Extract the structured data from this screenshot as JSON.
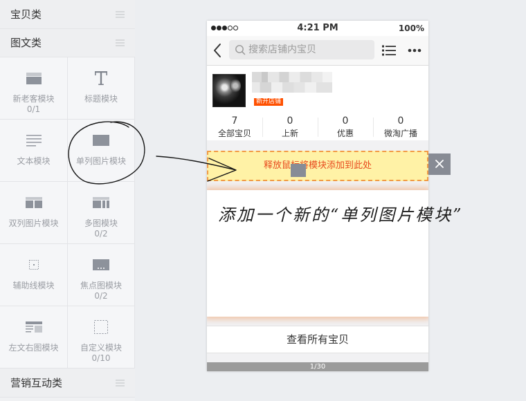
{
  "sidebar": {
    "categories": [
      {
        "label": "宝贝类",
        "icon": "drag-handle-icon"
      },
      {
        "label": "图文类",
        "icon": "drag-handle-icon"
      },
      {
        "label": "营销互动类",
        "icon": "drag-handle-icon"
      }
    ],
    "modules": [
      {
        "label": "新老客模块",
        "count": "0/1",
        "icon": "new-old-customer-module-icon"
      },
      {
        "label": "标题模块",
        "icon": "title-module-icon"
      },
      {
        "label": "文本模块",
        "icon": "text-module-icon"
      },
      {
        "label": "单列图片模块",
        "icon": "single-image-module-icon"
      },
      {
        "label": "双列图片模块",
        "icon": "double-image-module-icon"
      },
      {
        "label": "多图模块",
        "count": "0/2",
        "icon": "multi-image-module-icon"
      },
      {
        "label": "辅助线模块",
        "icon": "guide-line-module-icon"
      },
      {
        "label": "焦点图模块",
        "count": "0/2",
        "icon": "focus-image-module-icon"
      },
      {
        "label": "左文右图模块",
        "icon": "text-left-image-right-module-icon"
      },
      {
        "label": "自定义模块",
        "count": "0/10",
        "icon": "custom-module-icon"
      }
    ]
  },
  "preview": {
    "status_bar": {
      "signal_level": 3,
      "signal_max": 5,
      "time": "4:21 PM",
      "battery": "100%"
    },
    "nav": {
      "search_placeholder": "搜索店铺内宝贝",
      "icons": [
        "back-icon",
        "search-icon",
        "list-icon",
        "more-icon"
      ]
    },
    "shop": {
      "badge": "新开店铺"
    },
    "stats": [
      {
        "value": "7",
        "label": "全部宝贝"
      },
      {
        "value": "0",
        "label": "上新"
      },
      {
        "value": "0",
        "label": "优惠"
      },
      {
        "value": "0",
        "label": "微淘广播"
      }
    ],
    "drop_zone": {
      "text": "释放鼠标将模块添加到此处",
      "close_icon": "close-icon"
    },
    "new_module": {
      "annotation": "添加一个新的“单列图片模块”"
    },
    "view_all": {
      "label": "查看所有宝贝"
    },
    "pager": {
      "text": "1/30"
    }
  },
  "colors": {
    "accent": "#ff5000",
    "drop_zone_bg": "#fff2a6",
    "drop_zone_border": "#f19a45",
    "drop_zone_text": "#e8491d",
    "annotation_ink": "#1e1e1e"
  }
}
